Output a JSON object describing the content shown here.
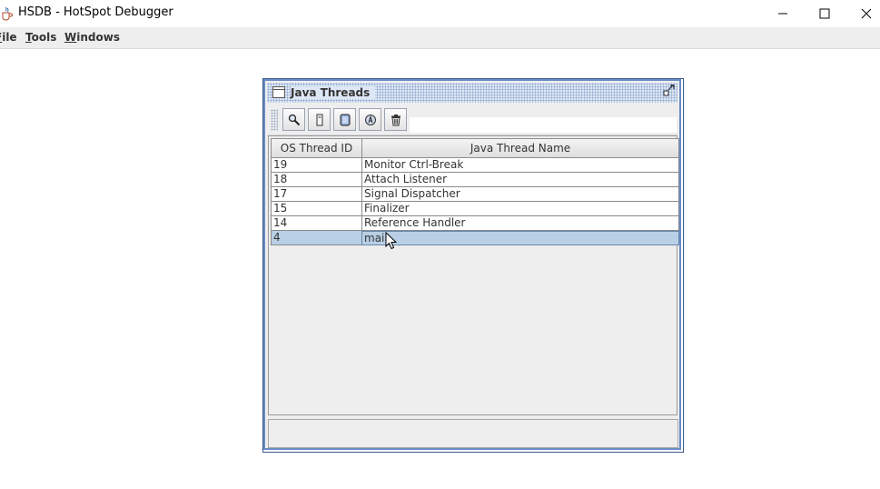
{
  "window": {
    "title": "HSDB - HotSpot Debugger",
    "app_icon": "java-cup-icon",
    "controls": [
      "minimize-icon",
      "maximize-icon",
      "close-icon"
    ]
  },
  "menubar": {
    "items": [
      {
        "label": "File"
      },
      {
        "label": "Tools"
      },
      {
        "label": "Windows"
      }
    ]
  },
  "java_threads_frame": {
    "title": "Java Threads",
    "frame_icon": "window-icon",
    "restore_icon": "restore-icon",
    "toolbar": {
      "buttons": [
        {
          "icon": "inspect-magnifier-icon"
        },
        {
          "icon": "stack-memory-icon"
        },
        {
          "icon": "thread-info-icon"
        },
        {
          "icon": "find-crashes-icon"
        },
        {
          "icon": "trash-icon"
        }
      ]
    },
    "table": {
      "columns": [
        "OS Thread ID",
        "Java Thread Name"
      ],
      "rows": [
        {
          "id": "19",
          "name": "Monitor Ctrl-Break"
        },
        {
          "id": "18",
          "name": "Attach Listener"
        },
        {
          "id": "17",
          "name": "Signal Dispatcher"
        },
        {
          "id": "15",
          "name": "Finalizer"
        },
        {
          "id": "14",
          "name": "Reference Handler"
        },
        {
          "id": "4",
          "name": "main"
        }
      ],
      "selected_row_index": 5
    }
  },
  "colors": {
    "frame_border": "#6b8cc4",
    "selection": "#b8cfe5",
    "panel_bg": "#eeeeee"
  }
}
